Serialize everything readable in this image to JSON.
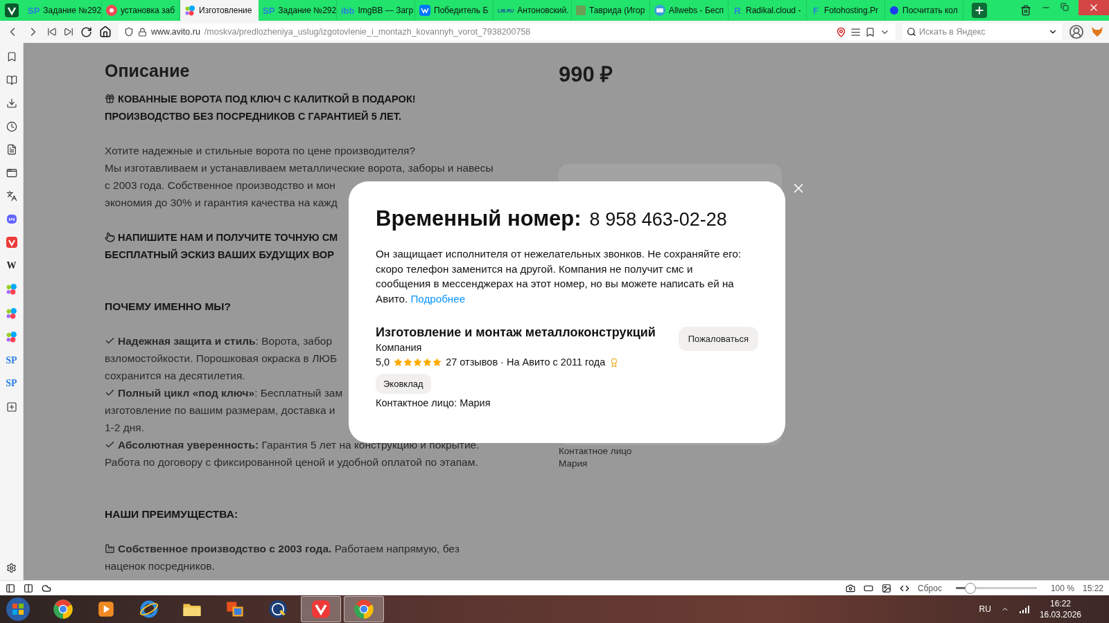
{
  "browser": {
    "tabs": [
      {
        "label": "Задание №292",
        "selected": false,
        "kind": "letters",
        "mark": "SP"
      },
      {
        "label": "установка заб",
        "selected": false,
        "kind": "record"
      },
      {
        "label": "Изготовление",
        "selected": true,
        "kind": "dots"
      },
      {
        "label": "Задание №292",
        "selected": false,
        "kind": "letters",
        "mark": "SP"
      },
      {
        "label": "ImgBB — Загр",
        "selected": false,
        "kind": "letters",
        "mark": "ibb"
      },
      {
        "label": "Победитель Б",
        "selected": false,
        "kind": "vk"
      },
      {
        "label": "Антоновский.",
        "selected": false,
        "kind": "letters",
        "mark": "LIB.RU"
      },
      {
        "label": "Таврида (Игор",
        "selected": false,
        "kind": "square"
      },
      {
        "label": "Allwebs - Бесп",
        "selected": false,
        "kind": "card"
      },
      {
        "label": "Radikal.cloud -",
        "selected": false,
        "kind": "letters",
        "mark": "R"
      },
      {
        "label": "Fotohosting.Pr",
        "selected": false,
        "kind": "letters",
        "mark": "F"
      },
      {
        "label": "Посчитать кол",
        "selected": false,
        "kind": "circle"
      }
    ],
    "address": {
      "host": "www.avito.ru",
      "path": "/moskva/predlozheniya_uslug/izgotovlenie_i_montazh_kovannyh_vorot_7938200758"
    },
    "search": {
      "placeholder": "Искать в Яндекс"
    }
  },
  "sidebar": {
    "panels": [
      {
        "kind": "bookmarks"
      },
      {
        "kind": "reader"
      },
      {
        "kind": "downloads"
      },
      {
        "kind": "history"
      },
      {
        "kind": "notes"
      },
      {
        "kind": "window"
      },
      {
        "kind": "translate"
      },
      {
        "kind": "mastodon"
      },
      {
        "kind": "vivaldi"
      },
      {
        "kind": "letters",
        "mark": "W"
      },
      {
        "kind": "dots"
      },
      {
        "kind": "dots"
      },
      {
        "kind": "dots"
      },
      {
        "kind": "letters",
        "mark": "SP"
      },
      {
        "kind": "letters",
        "mark": "SP"
      },
      {
        "kind": "add"
      }
    ]
  },
  "page": {
    "heading": "Описание",
    "blocks": [
      {
        "kind": "lead",
        "lines": [
          {
            "kind": "gift",
            "text": "КОВАННЫЕ ВОРОТА ПОД КЛЮЧ С КАЛИТКОЙ В ПОДАРОК!"
          },
          {
            "text": "ПРОИЗВОДСТВО БЕЗ ПОСРЕДНИКОВ С ГАРАНТИЕЙ 5 ЛЕТ."
          }
        ]
      },
      {
        "kind": "text",
        "lines": [
          {
            "text": "Хотите надежные и стильные ворота по цене производителя?"
          },
          {
            "text": "Мы изготавливаем и устанавливаем металлические ворота, заборы и навесы"
          },
          {
            "text": "с 2003 года. Собственное производство и мон"
          },
          {
            "text": "экономия до 30% и гарантия качества на кажд"
          }
        ]
      },
      {
        "kind": "lead",
        "lines": [
          {
            "kind": "hand",
            "text": "НАПИШИТЕ НАМ И ПОЛУЧИТЕ ТОЧНУЮ СМ"
          },
          {
            "text": "БЕСПЛАТНЫЙ ЭСКИЗ ВАШИХ БУДУЩИХ ВОР"
          }
        ]
      },
      {
        "kind": "section",
        "lines": [
          {
            "text": "ПОЧЕМУ ИМЕННО МЫ?"
          }
        ]
      },
      {
        "kind": "text",
        "lines": [
          {
            "kind": "check",
            "text": "**Надежная защита и стиль**: Ворота, забор"
          },
          {
            "text": "взломостойкости. Порошковая окраска в ЛЮБ"
          },
          {
            "text": "сохранится на десятилетия."
          },
          {
            "kind": "check",
            "text": "**Полный цикл «под ключ»**: Бесплатный зам"
          },
          {
            "text": "изготовление по вашим размерам, доставка и"
          },
          {
            "text": "1-2 дня."
          },
          {
            "kind": "check",
            "text": "**Абсолютная уверенность:** Гарантия 5 лет на конструкцию и покрытие."
          },
          {
            "text": "Работа по договору с фиксированной ценой и удобной оплатой по этапам."
          }
        ]
      },
      {
        "kind": "section",
        "lines": [
          {
            "text": "НАШИ ПРЕИМУЩЕСТВА:"
          }
        ]
      },
      {
        "kind": "text",
        "lines": [
          {
            "kind": "factory",
            "text": "**Собственное производство с 2003 года.** Работаем напрямую, без"
          },
          {
            "text": "наценок посредников."
          }
        ]
      }
    ],
    "price": "990 ₽",
    "contact": {
      "label": "Контактное лицо",
      "name": "Мария"
    }
  },
  "dialog": {
    "title": "Временный номер:",
    "phone": "8 958 463-02-28",
    "notice": "Он защищает исполнителя от нежелательных звонков. Не сохраняйте его: скоро телефон заменится на другой. Компания не получит смс и сообщения в мессенджерах на этот номер, но вы можете написать ей на Авито.",
    "link": "Подробнее",
    "seller": {
      "name": "Изготовление и монтаж металлоконструкций",
      "type": "Компания",
      "rating": "5,0",
      "stars": 5,
      "reviews": "27 отзывов · На Авито с 2011 года",
      "tag": "Эковклад",
      "contact": "Контактное лицо: Мария"
    },
    "report": "Пожаловаться"
  },
  "status_bar": {
    "reset": "Сброс",
    "zoom": {
      "level": 0.18
    },
    "zoom_reading": "100 %",
    "time": "15:22"
  },
  "taskbar": {
    "apps": [
      {
        "kind": "chrome",
        "open": false
      },
      {
        "kind": "media",
        "open": false
      },
      {
        "kind": "ie",
        "open": false
      },
      {
        "kind": "folder",
        "open": false
      },
      {
        "kind": "office",
        "open": false
      },
      {
        "kind": "hp",
        "open": false
      },
      {
        "kind": "vivaldi",
        "open": true
      },
      {
        "kind": "chrome",
        "open": true
      }
    ],
    "language": "RU",
    "time": "16:22",
    "date": "16.03.2026"
  }
}
